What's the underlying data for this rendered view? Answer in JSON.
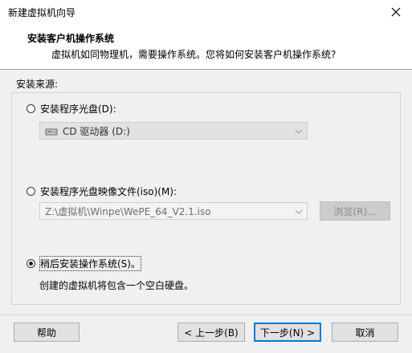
{
  "window": {
    "title": "新建虚拟机向导",
    "close_glyph": "✕"
  },
  "header": {
    "title": "安装客户机操作系统",
    "subtitle": "虚拟机如同物理机，需要操作系统。您将如何安装客户机操作系统?"
  },
  "source_label": "安装来源:",
  "options": {
    "disc": {
      "label": "安装程序光盘(D):",
      "selected": false
    },
    "disc_combo": {
      "value": "CD 驱动器 (D:)",
      "icon": "cd-drive-icon"
    },
    "iso": {
      "label": "安装程序光盘映像文件(iso)(M):",
      "selected": false
    },
    "iso_combo": {
      "value": "Z:\\虚拟机\\Winpe\\WePE_64_V2.1.iso"
    },
    "browse_label": "浏览(R)...",
    "later": {
      "label": "稍后安装操作系统(S)。",
      "selected": true
    },
    "later_desc": "创建的虚拟机将包含一个空白硬盘。"
  },
  "footer": {
    "help": "帮助",
    "back": "< 上一步(B)",
    "next": "下一步(N) >",
    "cancel": "取消"
  }
}
